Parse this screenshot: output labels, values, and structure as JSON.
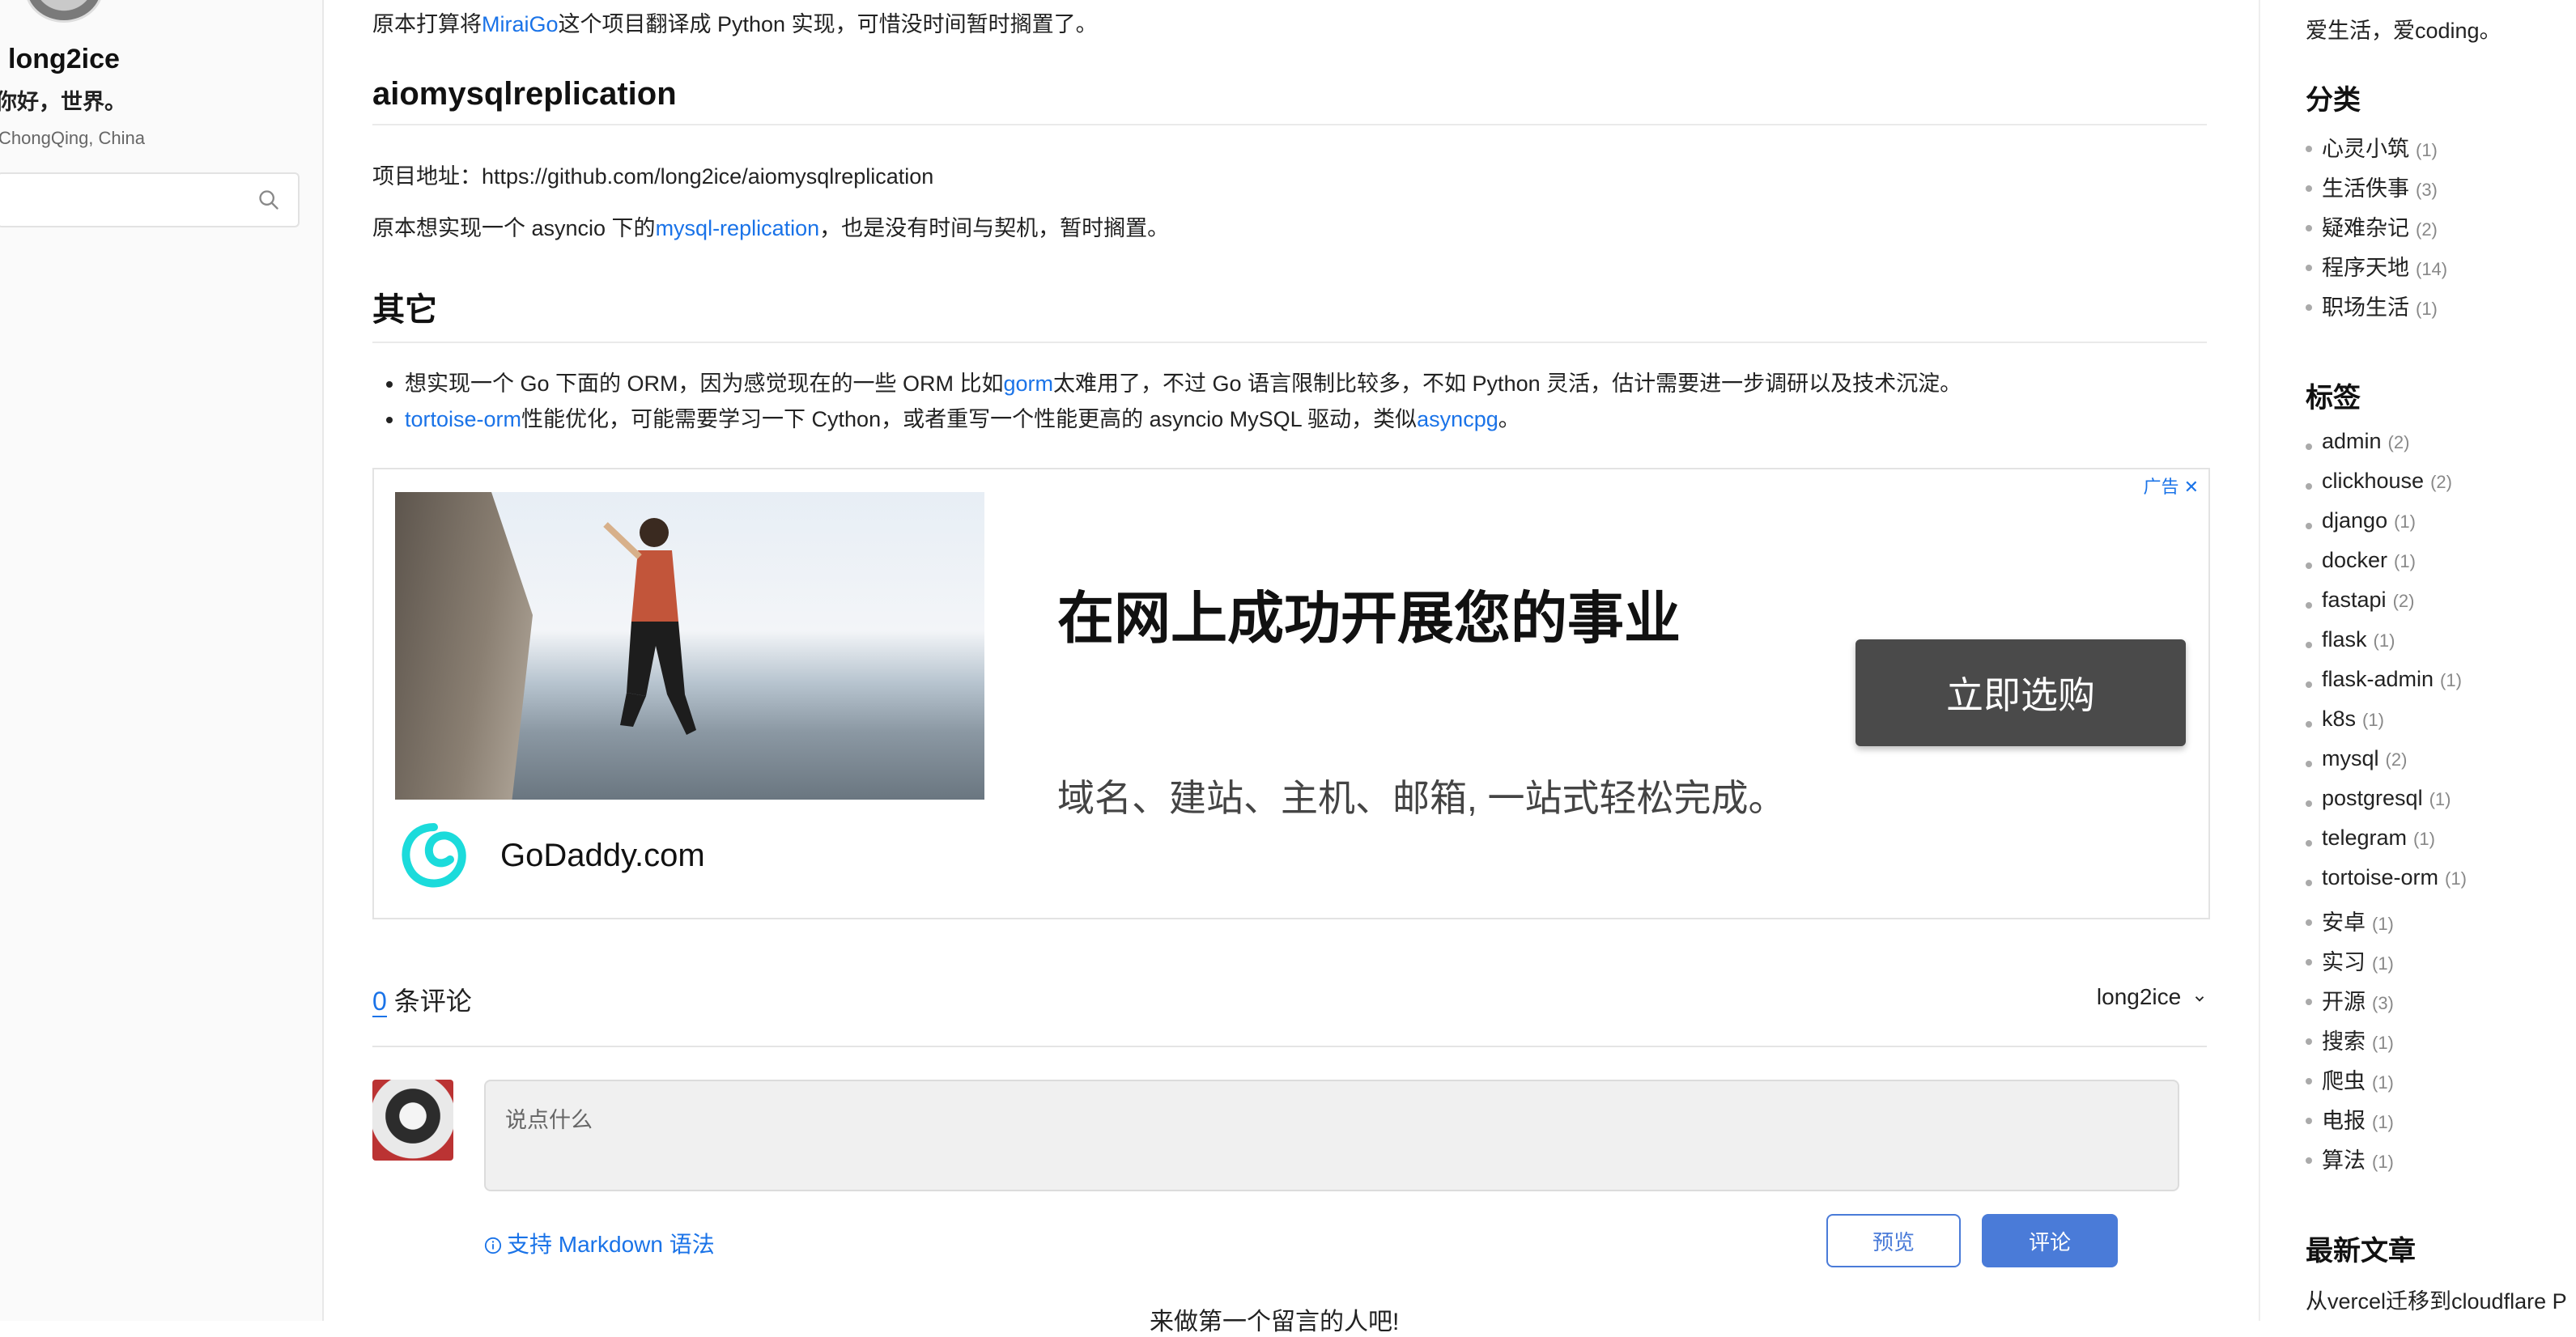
{
  "profile": {
    "name": "long2ice",
    "tagline": "你好，世界。",
    "location": "ChongQing, China",
    "search_placeholder": ""
  },
  "article": {
    "intro": {
      "before": "原本打算将",
      "link": "MiraiGo",
      "after": "这个项目翻译成 Python 实现，可惜没时间暂时搁置了。"
    },
    "heading_aiomysql": "aiomysqlreplication",
    "repo_line": "项目地址：https://github.com/long2ice/aiomysqlreplication",
    "aiomysql_desc": {
      "before": "原本想实现一个 asyncio 下的",
      "link": "mysql-replication",
      "after": "，也是没有时间与契机，暂时搁置。"
    },
    "heading_others": "其它",
    "others": [
      {
        "before": "想实现一个 Go 下面的 ORM，因为感觉现在的一些 ORM 比如",
        "link": "gorm",
        "after": "太难用了，不过 Go 语言限制比较多，不如 Python 灵活，估计需要进一步调研以及技术沉淀。"
      },
      {
        "link": "tortoise-orm",
        "middle": "性能优化，可能需要学习一下 Cython，或者重写一个性能更高的 asyncio MySQL 驱动，类似",
        "link2": "asyncpg",
        "after": "。"
      }
    ]
  },
  "ad": {
    "badge": "广告 ✕",
    "brand": "GoDaddy.com",
    "headline": "在网上成功开展您的事业",
    "cta": "立即选购",
    "subline": "域名、建站、主机、邮箱, 一站式轻松完成。"
  },
  "comments": {
    "count": "0",
    "count_suffix": " 条评论",
    "current_user": "long2ice",
    "input_placeholder": "说点什么",
    "markdown_hint": "支持 Markdown 语法",
    "preview_label": "预览",
    "submit_label": "评论",
    "empty_hint": "来做第一个留言的人吧!"
  },
  "sidebar": {
    "motto": "爱生活，爱coding。",
    "categories_heading": "分类",
    "categories": [
      {
        "name": "心灵小筑",
        "count": "(1)"
      },
      {
        "name": "生活佚事",
        "count": "(3)"
      },
      {
        "name": "疑难杂记",
        "count": "(2)"
      },
      {
        "name": "程序天地",
        "count": "(14)"
      },
      {
        "name": "职场生活",
        "count": "(1)"
      }
    ],
    "tags_heading": "标签",
    "tags": [
      {
        "name": "admin",
        "count": "(2)"
      },
      {
        "name": "clickhouse",
        "count": "(2)"
      },
      {
        "name": "django",
        "count": "(1)"
      },
      {
        "name": "docker",
        "count": "(1)"
      },
      {
        "name": "fastapi",
        "count": "(2)"
      },
      {
        "name": "flask",
        "count": "(1)"
      },
      {
        "name": "flask-admin",
        "count": "(1)"
      },
      {
        "name": "k8s",
        "count": "(1)"
      },
      {
        "name": "mysql",
        "count": "(2)"
      },
      {
        "name": "postgresql",
        "count": "(1)"
      },
      {
        "name": "telegram",
        "count": "(1)"
      },
      {
        "name": "tortoise-orm",
        "count": "(1)"
      },
      {
        "name": "安卓",
        "count": "(1)"
      },
      {
        "name": "实习",
        "count": "(1)"
      },
      {
        "name": "开源",
        "count": "(3)"
      },
      {
        "name": "搜索",
        "count": "(1)"
      },
      {
        "name": "爬虫",
        "count": "(1)"
      },
      {
        "name": "电报",
        "count": "(1)"
      },
      {
        "name": "算法",
        "count": "(1)"
      }
    ],
    "latest_heading": "最新文章",
    "latest_post": "从vercel迁移到cloudflare P"
  },
  "colors": {
    "link": "#1a73e8",
    "button": "#4a7bd8",
    "ad_cta": "#4a4a4a"
  },
  "icons": [
    "search-icon",
    "info-icon",
    "chevron-down-icon",
    "godaddy-logo-icon",
    "close-icon"
  ]
}
